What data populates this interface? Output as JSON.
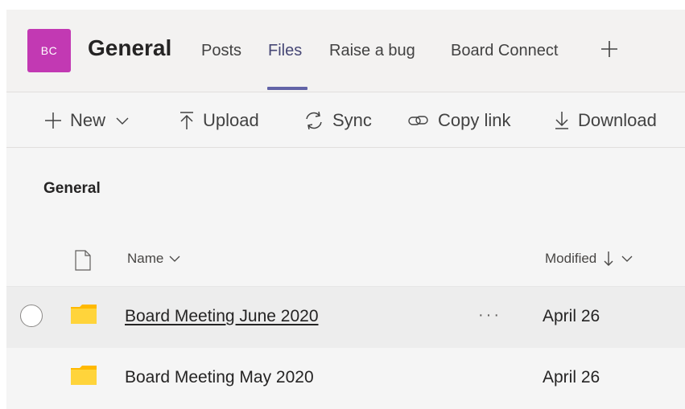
{
  "team": {
    "initials": "BC",
    "avatar_color": "#c239b3",
    "name": "General"
  },
  "tabs": [
    {
      "label": "Posts",
      "active": false
    },
    {
      "label": "Files",
      "active": true
    },
    {
      "label": "Raise a bug",
      "active": false
    },
    {
      "label": "Board Connect",
      "active": false
    }
  ],
  "add_tab_icon": "plus-icon",
  "toolbar": {
    "new": "New",
    "upload": "Upload",
    "sync": "Sync",
    "copy_link": "Copy link",
    "download": "Download"
  },
  "breadcrumb": "General",
  "columns": {
    "name": "Name",
    "modified": "Modified"
  },
  "files": [
    {
      "name": "Board Meeting June 2020",
      "modified": "April 26",
      "type": "folder",
      "hovered": true,
      "more": "···"
    },
    {
      "name": "Board Meeting May 2020",
      "modified": "April 26",
      "type": "folder",
      "hovered": false
    }
  ],
  "colors": {
    "accent": "#6264a7",
    "active_tab": "#464775",
    "folder": "#ffd43b"
  }
}
